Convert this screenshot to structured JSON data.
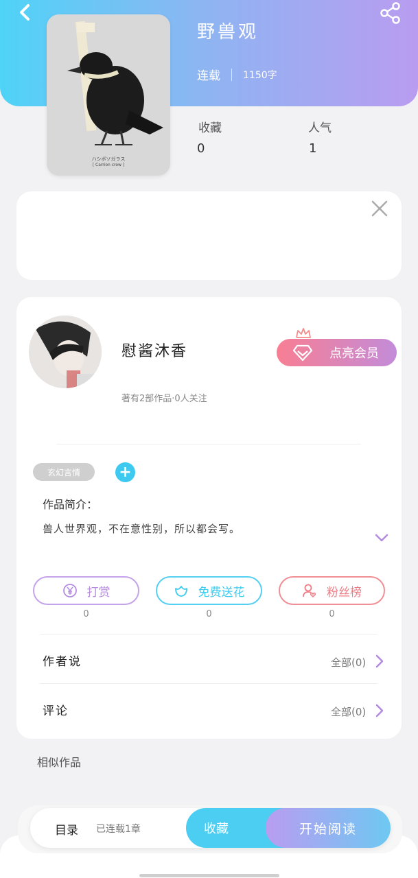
{
  "header": {
    "title": "野兽观",
    "status": "连载",
    "word_count": "1150字",
    "stats": [
      {
        "label": "收藏",
        "value": "0"
      },
      {
        "label": "人气",
        "value": "1"
      }
    ]
  },
  "cover": {
    "caption_line1": "ハシボソガラス",
    "caption_line2": "[ Carrion crow ]"
  },
  "author": {
    "name": "慰酱沐香",
    "meta": "著有2部作品·0人关注",
    "vip_button": "点亮会员"
  },
  "tags": [
    "玄幻言情"
  ],
  "tag_add": "+",
  "intro": {
    "title": "作品简介：",
    "text": "兽人世界观，不在意性别，所以都会写。"
  },
  "actions": [
    {
      "label": "打赏",
      "count": "0",
      "color": "#b48be0"
    },
    {
      "label": "免费送花",
      "count": "0",
      "color": "#3ecbef"
    },
    {
      "label": "粉丝榜",
      "count": "0",
      "color": "#ee7b84"
    }
  ],
  "rows": [
    {
      "title": "作者说",
      "all": "全部(0)"
    },
    {
      "title": "评论",
      "all": "全部(0)"
    }
  ],
  "similar_title": "相似作品",
  "bottom": {
    "toc": "目录",
    "toc_sub": "已连载1章",
    "favorite": "收藏",
    "start_reading": "开始阅读"
  }
}
